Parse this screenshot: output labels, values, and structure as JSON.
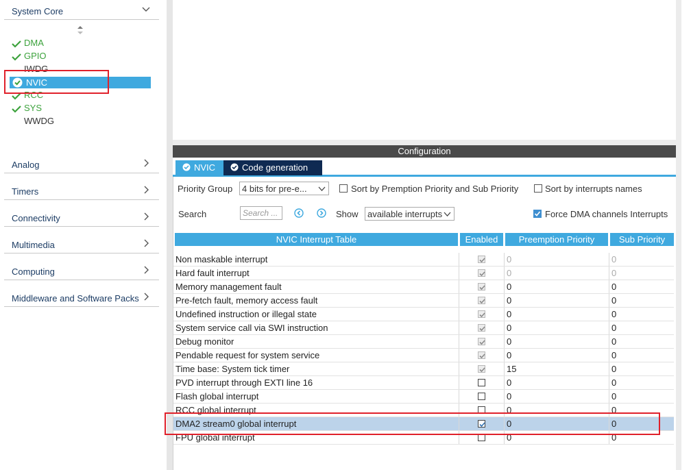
{
  "sidebar": {
    "sections_top": [
      {
        "label": "System Core"
      }
    ],
    "system_core_items": [
      {
        "label": "DMA",
        "status": "ok"
      },
      {
        "label": "GPIO",
        "status": "ok"
      },
      {
        "label": "IWDG",
        "status": "none"
      },
      {
        "label": "NVIC",
        "status": "selected"
      },
      {
        "label": "RCC",
        "status": "ok"
      },
      {
        "label": "SYS",
        "status": "ok"
      },
      {
        "label": "WWDG",
        "status": "none"
      }
    ],
    "sections": [
      {
        "label": "Analog"
      },
      {
        "label": "Timers"
      },
      {
        "label": "Connectivity"
      },
      {
        "label": "Multimedia"
      },
      {
        "label": "Computing"
      },
      {
        "label": "Middleware and Software Packs"
      }
    ]
  },
  "config": {
    "title": "Configuration",
    "tabs": [
      {
        "label": "NVIC"
      },
      {
        "label": "Code generation"
      }
    ],
    "priority_group_label": "Priority Group",
    "priority_group_value": "4 bits for pre-e...",
    "sort_premption_label": "Sort by Premption Priority and Sub Priority",
    "sort_names_label": "Sort by interrupts names",
    "search_label": "Search",
    "search_placeholder": "Search ...",
    "show_label": "Show",
    "show_value": "available interrupts",
    "force_dma_label": "Force DMA channels Interrupts",
    "force_dma_checked": true
  },
  "table": {
    "headers": [
      "NVIC Interrupt Table",
      "Enabled",
      "Preemption Priority",
      "Sub Priority"
    ],
    "rows": [
      {
        "name": "Non maskable interrupt",
        "enabled": true,
        "locked": true,
        "pp": "0",
        "sp": "0",
        "prio_disabled": true
      },
      {
        "name": "Hard fault interrupt",
        "enabled": true,
        "locked": true,
        "pp": "0",
        "sp": "0",
        "prio_disabled": true
      },
      {
        "name": "Memory management fault",
        "enabled": true,
        "locked": true,
        "pp": "0",
        "sp": "0",
        "prio_disabled": false
      },
      {
        "name": "Pre-fetch fault, memory access fault",
        "enabled": true,
        "locked": true,
        "pp": "0",
        "sp": "0",
        "prio_disabled": false
      },
      {
        "name": "Undefined instruction or illegal state",
        "enabled": true,
        "locked": true,
        "pp": "0",
        "sp": "0",
        "prio_disabled": false
      },
      {
        "name": "System service call via SWI instruction",
        "enabled": true,
        "locked": true,
        "pp": "0",
        "sp": "0",
        "prio_disabled": false
      },
      {
        "name": "Debug monitor",
        "enabled": true,
        "locked": true,
        "pp": "0",
        "sp": "0",
        "prio_disabled": false
      },
      {
        "name": "Pendable request for system service",
        "enabled": true,
        "locked": true,
        "pp": "0",
        "sp": "0",
        "prio_disabled": false
      },
      {
        "name": "Time base: System tick timer",
        "enabled": true,
        "locked": true,
        "pp": "15",
        "sp": "0",
        "prio_disabled": false
      },
      {
        "name": "PVD interrupt through EXTI line 16",
        "enabled": false,
        "locked": false,
        "pp": "0",
        "sp": "0",
        "prio_disabled": false
      },
      {
        "name": "Flash global interrupt",
        "enabled": false,
        "locked": false,
        "pp": "0",
        "sp": "0",
        "prio_disabled": false
      },
      {
        "name": "RCC global interrupt",
        "enabled": false,
        "locked": false,
        "pp": "0",
        "sp": "0",
        "prio_disabled": false
      },
      {
        "name": "DMA2 stream0 global interrupt",
        "enabled": true,
        "locked": false,
        "pp": "0",
        "sp": "0",
        "prio_disabled": false,
        "selected": true
      },
      {
        "name": "FPU global interrupt",
        "enabled": false,
        "locked": false,
        "pp": "0",
        "sp": "0",
        "prio_disabled": false
      }
    ]
  },
  "colors": {
    "accent": "#3fa9df",
    "ok_green": "#3ca23c",
    "highlight_red": "#e0202a",
    "dark_tab": "#0f2a52"
  }
}
